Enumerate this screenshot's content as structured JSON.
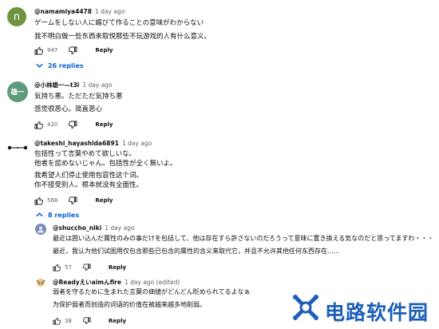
{
  "comments": [
    {
      "author": "@namamiya4478",
      "time": "1 day ago",
      "avatar_letter": "n",
      "avatar_color": "#6f9440",
      "lines": [
        "ゲームをしない人に媚びて作ることの意味がわからない",
        "我不明白做一些东西来取悦那些不玩游戏的人有什么意义。"
      ],
      "likes": "947",
      "reply_label": "Reply",
      "replies_toggle": "26 replies"
    },
    {
      "author": "@小林雄一—t3i",
      "time": "1 day ago",
      "avatar_letter": "雄一",
      "avatar_color": "#5f9a7a",
      "lines": [
        "気持ち悪。ただただ気持ち悪",
        "感觉很恶心。简直恶心"
      ],
      "likes": "420",
      "reply_label": "Reply"
    },
    {
      "author": "@takeshi_hayashida6891",
      "time": "1 day ago",
      "lines": [
        "包括性って言葉やめて欲しいな。",
        "他者を認めないじゃん。包括性が全く無いよ。",
        "我希望人们停止使用包容性这个词。",
        "你不接受别人。根本就没有全面性。"
      ],
      "likes": "568",
      "reply_label": "Reply",
      "replies_toggle": "8 replies"
    }
  ],
  "replies": [
    {
      "author": "@shuccho_niki",
      "time": "1 day ago",
      "lines": [
        "最近は囲い込んだ属性のみの事だけを包括して、他は存在すら許さないのだろうって意味に置き換える気なのだと思ってますわ・・・",
        "最近，我认为他们试图用仅包含那些已包含的属性的含义来取代它，并且不允许其他任何东西存在......"
      ],
      "likes": "57",
      "reply_label": "Reply"
    },
    {
      "author": "@Readyえいaimんfire",
      "time": "1 day ago (edited)",
      "lines": [
        "弱者を守るために生まれた言葉の価値がどんどん貶められてるよなぁ",
        "为保护弱者而创造的词语的价值在被越来越多地削弱。"
      ],
      "likes": "38",
      "reply_label": "Reply"
    }
  ],
  "watermark": {
    "text": "电路软件园"
  },
  "icons": {
    "like": "thumb-up-icon",
    "dislike": "thumb-down-icon",
    "chevron": "chevron-down-icon",
    "logo": "watermark-logo-icon"
  },
  "colors": {
    "link": "#065fd4",
    "meta": "#606060",
    "watermark": "#1d5fb6"
  }
}
